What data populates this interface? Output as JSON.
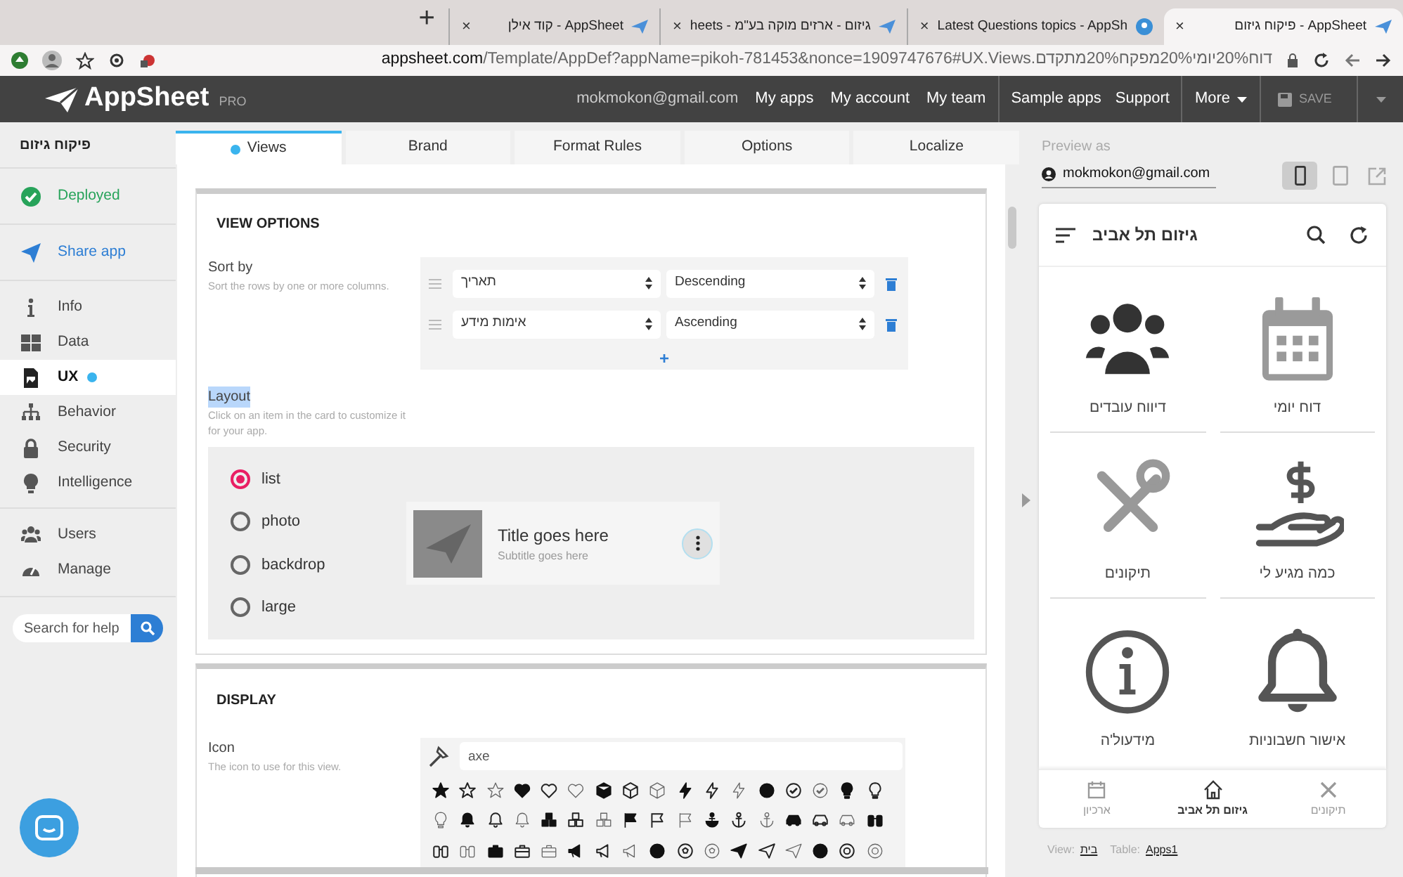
{
  "browser": {
    "tabs": [
      {
        "title": "קוד אילן - AppSheet",
        "selected": false
      },
      {
        "title": "heets - גיזום - ארזים מוקה בע\"מ",
        "selected": false
      },
      {
        "title": "Latest Questions topics - AppSh",
        "selected": false
      },
      {
        "title": "פיקוח גיזום - AppSheet",
        "selected": true
      }
    ],
    "new_tab": "+",
    "close": "×",
    "url_host": "appsheet.com",
    "url_path": "/Template/AppDef?appName=pikoh-781453&nonce=1909747676#UX.Views.דוח20%יומי20%מפקח20%מתקדם"
  },
  "header": {
    "logo": "AppSheet",
    "plan": "PRO",
    "links": [
      "mokmokon@gmail.com",
      "My apps",
      "My account",
      "My team"
    ],
    "links_2": [
      "Sample apps",
      "Support"
    ],
    "more": "More",
    "save": {
      "label": "SAVE",
      "disabled": true
    }
  },
  "sidebar": {
    "app_name": "פיקוח גיזום",
    "items": [
      {
        "label": "Deployed",
        "kind": "status",
        "selected": false,
        "dot": false
      },
      {
        "label": "Share app",
        "kind": "share",
        "selected": false,
        "dot": false
      },
      {
        "label": "Info",
        "kind": "nav",
        "selected": false,
        "dot": false
      },
      {
        "label": "Data",
        "kind": "nav",
        "selected": false,
        "dot": false
      },
      {
        "label": "UX",
        "kind": "nav",
        "selected": true,
        "dot": true
      },
      {
        "label": "Behavior",
        "kind": "nav",
        "selected": false,
        "dot": false
      },
      {
        "label": "Security",
        "kind": "nav",
        "selected": false,
        "dot": false
      },
      {
        "label": "Intelligence",
        "kind": "nav",
        "selected": false,
        "dot": false
      },
      {
        "label": "Users",
        "kind": "nav",
        "selected": false,
        "dot": false
      },
      {
        "label": "Manage",
        "kind": "nav",
        "selected": false,
        "dot": false
      }
    ],
    "search": {
      "placeholder": "Search for help"
    }
  },
  "editor_tabs": [
    {
      "label": "Views",
      "selected": true,
      "dot": true
    },
    {
      "label": "Brand",
      "selected": false,
      "dot": false
    },
    {
      "label": "Format Rules",
      "selected": false,
      "dot": false
    },
    {
      "label": "Options",
      "selected": false,
      "dot": false
    },
    {
      "label": "Localize",
      "selected": false,
      "dot": false
    }
  ],
  "view_options": {
    "title": "VIEW OPTIONS",
    "sort_by": {
      "label": "Sort by",
      "description": "Sort the rows by one or more columns.",
      "rows": [
        {
          "column": "תאריך",
          "order": "Descending"
        },
        {
          "column": "אימות מידע",
          "order": "Ascending"
        }
      ],
      "add": "+"
    },
    "layout": {
      "label": "Layout",
      "description": "Click on an item in the card to customize it for your app.",
      "options": [
        {
          "label": "list",
          "selected": true
        },
        {
          "label": "photo",
          "selected": false
        },
        {
          "label": "backdrop",
          "selected": false
        },
        {
          "label": "large",
          "selected": false
        }
      ],
      "card": {
        "title": "Title goes here",
        "subtitle": "Subtitle goes here"
      }
    }
  },
  "display": {
    "title": "DISPLAY",
    "icon": {
      "label": "Icon",
      "description": "The icon to use for this view.",
      "search_value": "axe"
    }
  },
  "preview": {
    "label": "Preview as",
    "user": "mokmokon@gmail.com",
    "devices": [
      {
        "selected": true
      },
      {
        "selected": false
      }
    ],
    "app": {
      "title": "גיזום תל אביב",
      "tiles": [
        {
          "label": "דיווח עובדים"
        },
        {
          "label": "דוח יומי"
        },
        {
          "label": "תיקונים"
        },
        {
          "label": "כמה מגיע לי"
        },
        {
          "label": "מידעול'ה"
        },
        {
          "label": "אישור חשבוניות"
        }
      ],
      "nav": [
        {
          "label": "תיקונים",
          "selected": false
        },
        {
          "label": "גיזום תל אביב",
          "selected": true
        },
        {
          "label": "ארכיון",
          "selected": false
        }
      ]
    },
    "footer": {
      "view_label": "View:",
      "view": "בית",
      "table_label": "Table:",
      "table": "Apps1"
    }
  }
}
